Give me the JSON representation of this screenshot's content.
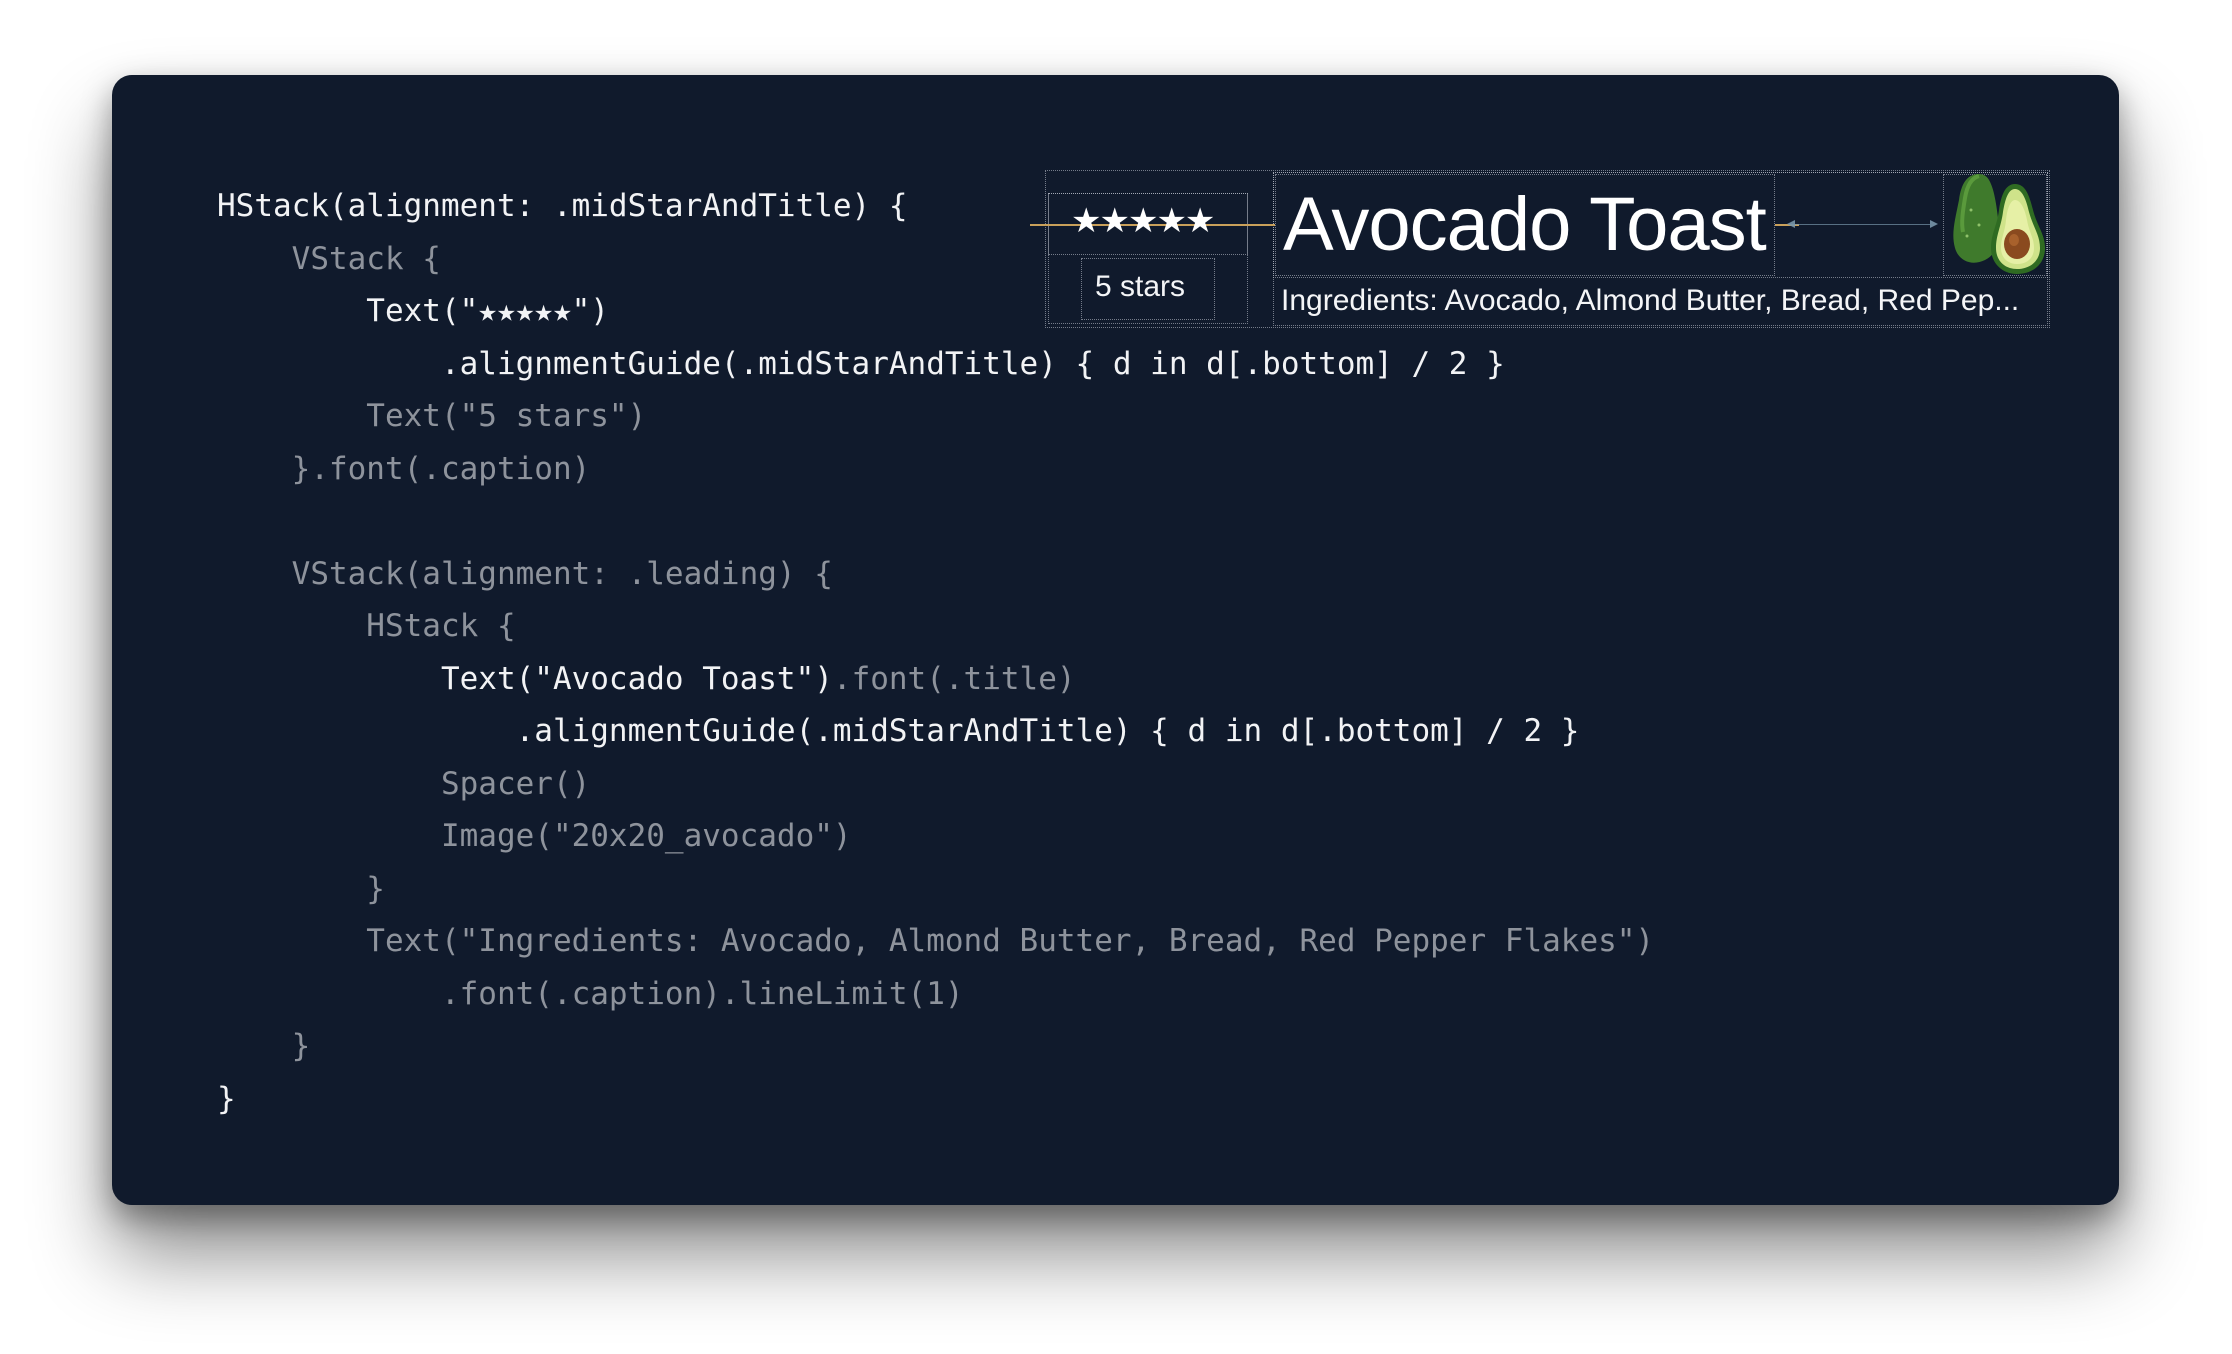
{
  "code_lines": [
    [
      {
        "t": "HStack(alignment: .midStarAndTitle) {",
        "s": "hi"
      }
    ],
    [
      {
        "t": "    VStack {",
        "s": "dim"
      }
    ],
    [
      {
        "t": "        Text(\"★★★★★\")",
        "s": "hi"
      }
    ],
    [
      {
        "t": "            .alignmentGuide(.midStarAndTitle) { d in d[.bottom] / 2 }",
        "s": "hi"
      }
    ],
    [
      {
        "t": "        Text(\"5 stars\")",
        "s": "dim"
      }
    ],
    [
      {
        "t": "    }.font(.caption)",
        "s": "dim"
      }
    ],
    [
      {
        "t": "",
        "s": "dim"
      }
    ],
    [
      {
        "t": "    VStack(alignment: .leading) {",
        "s": "dim"
      }
    ],
    [
      {
        "t": "        HStack {",
        "s": "dim"
      }
    ],
    [
      {
        "t": "            Text(\"Avocado Toast\")",
        "s": "hi"
      },
      {
        "t": ".font(.title)",
        "s": "dim"
      }
    ],
    [
      {
        "t": "                .alignmentGuide(.midStarAndTitle) { d in d[.bottom] / 2 }",
        "s": "hi"
      }
    ],
    [
      {
        "t": "            Spacer()",
        "s": "dim"
      }
    ],
    [
      {
        "t": "            Image(\"20x20_avocado\")",
        "s": "dim"
      }
    ],
    [
      {
        "t": "        }",
        "s": "dim"
      }
    ],
    [
      {
        "t": "        Text(\"Ingredients: Avocado, Almond Butter, Bread, Red Pepper Flakes\")",
        "s": "dim"
      }
    ],
    [
      {
        "t": "            .font(.caption).lineLimit(1)",
        "s": "dim"
      }
    ],
    [
      {
        "t": "    }",
        "s": "dim"
      }
    ],
    [
      {
        "t": "}",
        "s": "hi"
      }
    ]
  ],
  "preview": {
    "stars": "★★★★★",
    "stars_caption": "5 stars",
    "title": "Avocado Toast",
    "ingredients": "Ingredients: Avocado, Almond Butter, Bread, Red Pep...",
    "image_icon": "avocado-icon"
  },
  "colors": {
    "background": "#101a2c",
    "code_highlight": "#f2f3f5",
    "code_dim": "#8e939c",
    "alignment_guide": "#c9a05a"
  }
}
